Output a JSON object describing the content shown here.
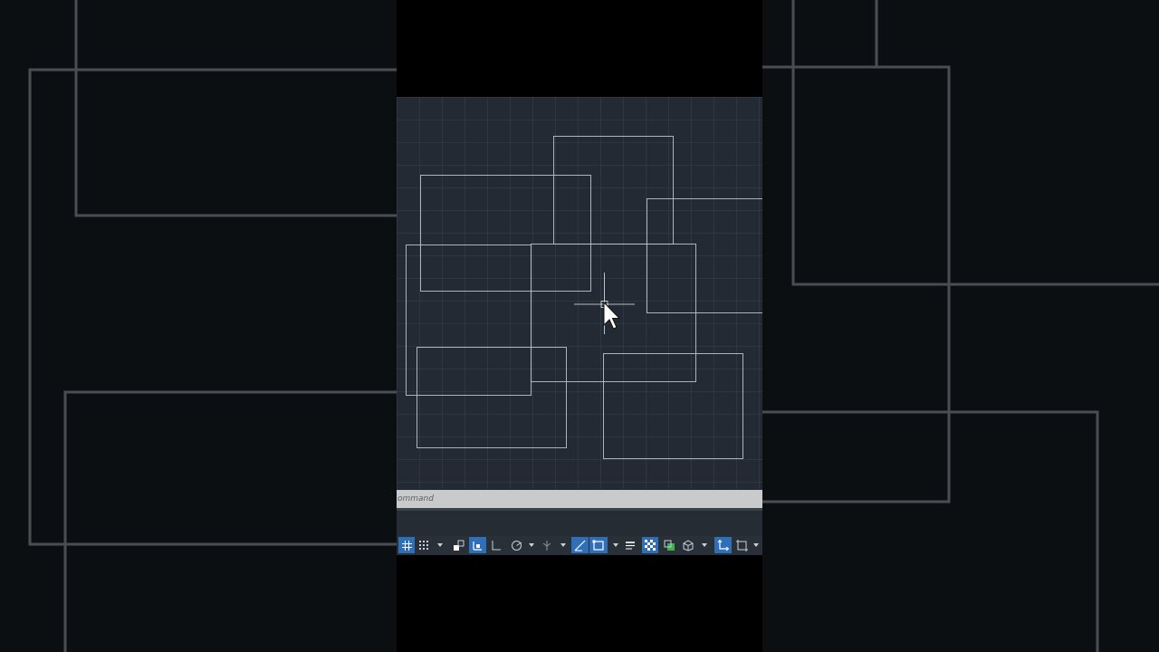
{
  "command": {
    "placeholder": "ommand"
  },
  "status_bar": {
    "buttons": [
      {
        "name": "grid-display",
        "icon": "grid-icon",
        "active": true
      },
      {
        "name": "snap-mode",
        "icon": "snap-dots-icon",
        "active": false
      },
      {
        "name": "snap-dropdown",
        "icon": "chevron-down-icon",
        "active": false
      },
      {
        "name": "model-space",
        "icon": "model-space-icon",
        "active": false
      },
      {
        "name": "infer-constraints",
        "icon": "infer-constraints-icon",
        "active": true
      },
      {
        "name": "ortho-mode",
        "icon": "ortho-icon",
        "active": false
      },
      {
        "name": "polar-tracking",
        "icon": "polar-tracking-icon",
        "active": false
      },
      {
        "name": "polar-dropdown",
        "icon": "chevron-down-icon",
        "active": false
      },
      {
        "name": "isometric-drafting",
        "icon": "isodraft-icon",
        "active": false
      },
      {
        "name": "isodraft-dropdown",
        "icon": "chevron-down-icon",
        "active": false
      },
      {
        "name": "object-snap-tracking",
        "icon": "snap-tracking-icon",
        "active": true
      },
      {
        "name": "object-snap",
        "icon": "object-snap-icon",
        "active": true
      },
      {
        "name": "osnap-dropdown",
        "icon": "chevron-down-icon",
        "active": false
      },
      {
        "name": "lineweight",
        "icon": "lineweight-icon",
        "active": false
      },
      {
        "name": "transparency",
        "icon": "transparency-icon",
        "active": true
      },
      {
        "name": "selection-cycling",
        "icon": "selection-cycling-icon",
        "active": false
      },
      {
        "name": "3d-object-snap",
        "icon": "3d-osnap-icon",
        "active": false
      },
      {
        "name": "3d-osnap-dropdown",
        "icon": "chevron-down-icon",
        "active": false
      },
      {
        "name": "dynamic-ucs",
        "icon": "dynamic-ucs-icon",
        "active": true
      },
      {
        "name": "selection-filter",
        "icon": "selection-filter-icon",
        "active": false
      },
      {
        "name": "filter-dropdown",
        "icon": "chevron-down-icon",
        "active": false
      }
    ]
  },
  "colors": {
    "viewport_bg": "#232a33",
    "rectangle_stroke": "#d7dde4",
    "active_button": "#2f6fb8",
    "command_bar": "#c9cacc"
  },
  "cursor": {
    "icon": "crosshair-cursor-icon"
  }
}
